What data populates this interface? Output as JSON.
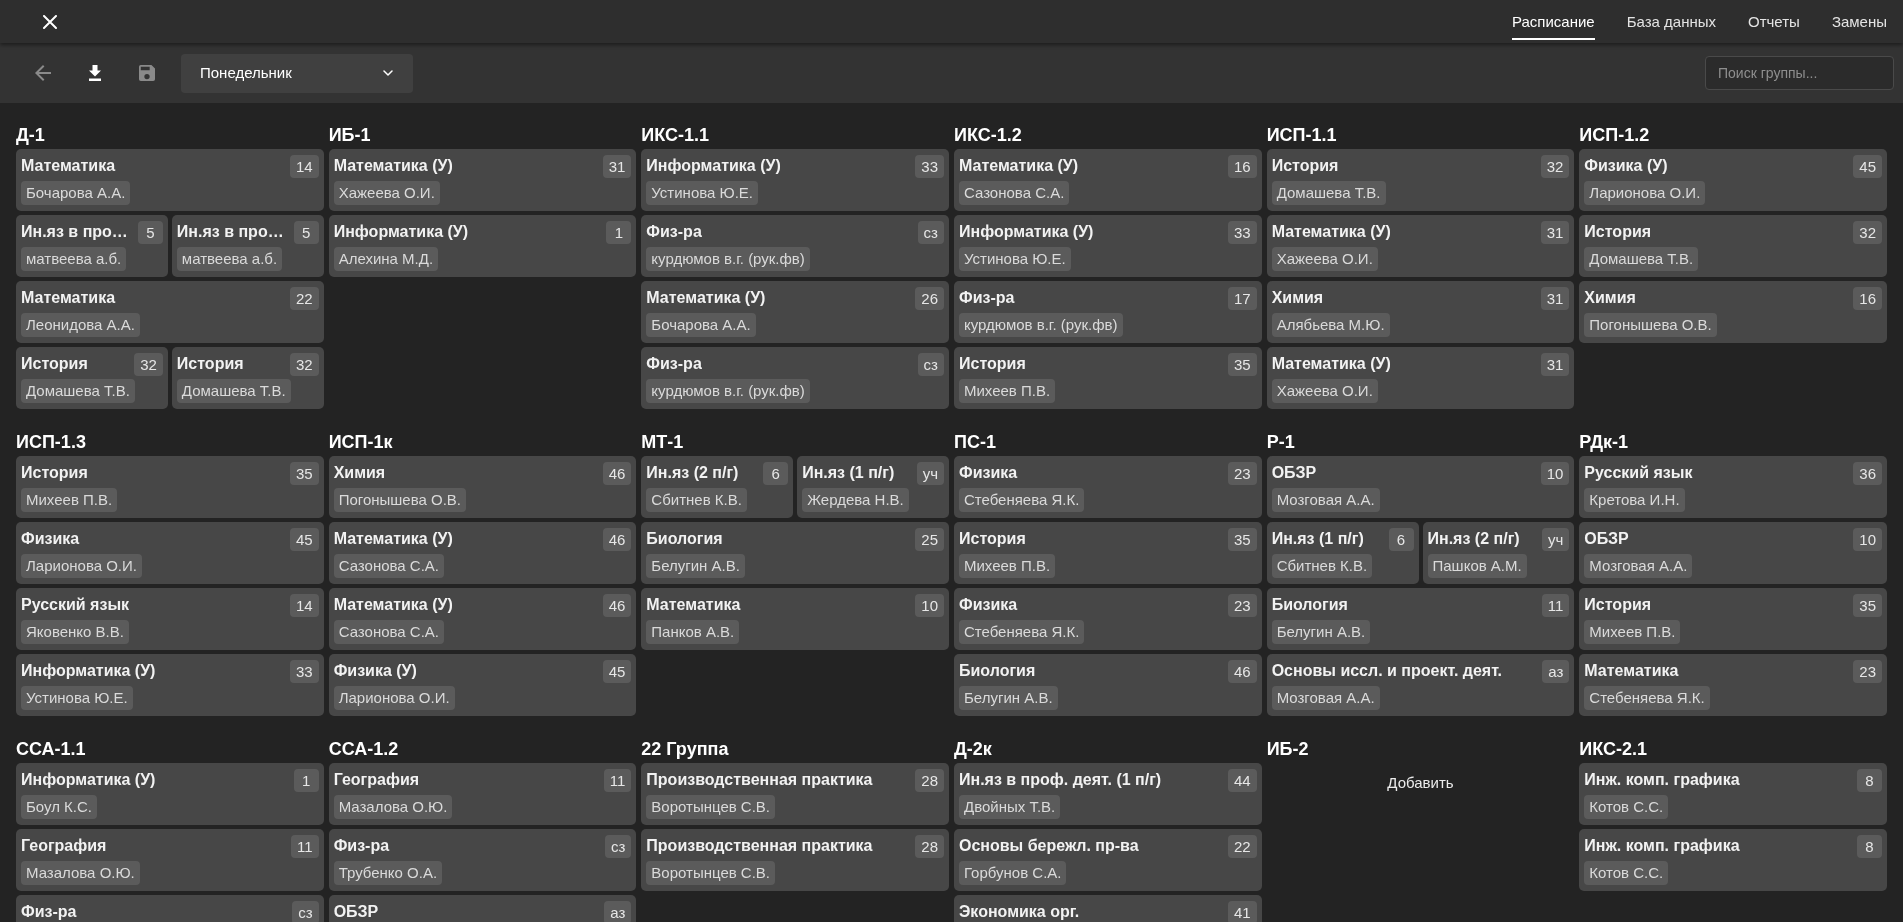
{
  "tabs": [
    {
      "label": "Расписание",
      "selected": true
    },
    {
      "label": "База данных",
      "selected": false
    },
    {
      "label": "Отчеты",
      "selected": false
    },
    {
      "label": "Замены",
      "selected": false
    }
  ],
  "toolbar": {
    "buttons": [
      {
        "kind": "back",
        "disabled": true
      },
      {
        "kind": "download",
        "disabled": false
      },
      {
        "kind": "save",
        "disabled": true
      }
    ],
    "day_select": {
      "value": "Понедельник"
    },
    "search": {
      "placeholder": "Поиск группы..."
    }
  },
  "groups": [
    {
      "name": "Д-1",
      "slots": [
        {
          "lessons": [
            {
              "subject": "Математика",
              "teacher": "Бочарова А.А.",
              "room": "14"
            }
          ]
        },
        {
          "lessons": [
            {
              "subject": "Ин.яз в про…",
              "teacher": "матвеева а.б.",
              "room": "5"
            },
            {
              "subject": "Ин.яз в про…",
              "teacher": "матвеева а.б.",
              "room": "5"
            }
          ]
        },
        {
          "lessons": [
            {
              "subject": "Математика",
              "teacher": "Леонидова А.А.",
              "room": "22"
            }
          ]
        },
        {
          "lessons": [
            {
              "subject": "История",
              "teacher": "Домашева Т.В.",
              "room": "32"
            },
            {
              "subject": "История",
              "teacher": "Домашева Т.В.",
              "room": "32"
            }
          ]
        }
      ]
    },
    {
      "name": "ИБ-1",
      "slots": [
        {
          "lessons": [
            {
              "subject": "Математика (У)",
              "teacher": "Хажеева О.И.",
              "room": "31"
            }
          ]
        },
        {
          "lessons": [
            {
              "subject": "Информатика (У)",
              "teacher": "Алехина М.Д.",
              "room": "1"
            }
          ]
        }
      ]
    },
    {
      "name": "ИКС-1.1",
      "slots": [
        {
          "lessons": [
            {
              "subject": "Информатика (У)",
              "teacher": "Устинова Ю.Е.",
              "room": "33"
            }
          ]
        },
        {
          "lessons": [
            {
              "subject": "Физ-ра",
              "teacher": "курдюмов в.г. (рук.фв)",
              "room": "сз"
            }
          ]
        },
        {
          "lessons": [
            {
              "subject": "Математика (У)",
              "teacher": "Бочарова А.А.",
              "room": "26"
            }
          ]
        },
        {
          "lessons": [
            {
              "subject": "Физ-ра",
              "teacher": "курдюмов в.г. (рук.фв)",
              "room": "сз"
            }
          ]
        }
      ]
    },
    {
      "name": "ИКС-1.2",
      "slots": [
        {
          "lessons": [
            {
              "subject": "Математика (У)",
              "teacher": "Сазонова С.А.",
              "room": "16"
            }
          ]
        },
        {
          "lessons": [
            {
              "subject": "Информатика (У)",
              "teacher": "Устинова Ю.Е.",
              "room": "33"
            }
          ]
        },
        {
          "lessons": [
            {
              "subject": "Физ-ра",
              "teacher": "курдюмов в.г. (рук.фв)",
              "room": "17"
            }
          ]
        },
        {
          "lessons": [
            {
              "subject": "История",
              "teacher": "Михеев П.В.",
              "room": "35"
            }
          ]
        }
      ]
    },
    {
      "name": "ИСП-1.1",
      "slots": [
        {
          "lessons": [
            {
              "subject": "История",
              "teacher": "Домашева Т.В.",
              "room": "32"
            }
          ]
        },
        {
          "lessons": [
            {
              "subject": "Математика (У)",
              "teacher": "Хажеева О.И.",
              "room": "31"
            }
          ]
        },
        {
          "lessons": [
            {
              "subject": "Химия",
              "teacher": "Алябьева М.Ю.",
              "room": "31"
            }
          ]
        },
        {
          "lessons": [
            {
              "subject": "Математика (У)",
              "teacher": "Хажеева О.И.",
              "room": "31"
            }
          ]
        }
      ]
    },
    {
      "name": "ИСП-1.2",
      "slots": [
        {
          "lessons": [
            {
              "subject": "Физика (У)",
              "teacher": "Ларионова О.И.",
              "room": "45"
            }
          ]
        },
        {
          "lessons": [
            {
              "subject": "История",
              "teacher": "Домашева Т.В.",
              "room": "32"
            }
          ]
        },
        {
          "lessons": [
            {
              "subject": "Химия",
              "teacher": "Погонышева О.В.",
              "room": "16"
            }
          ]
        }
      ]
    },
    {
      "name": "ИСП-1.3",
      "slots": [
        {
          "lessons": [
            {
              "subject": "История",
              "teacher": "Михеев П.В.",
              "room": "35"
            }
          ]
        },
        {
          "lessons": [
            {
              "subject": "Физика",
              "teacher": "Ларионова О.И.",
              "room": "45"
            }
          ]
        },
        {
          "lessons": [
            {
              "subject": "Русский язык",
              "teacher": "Яковенко В.В.",
              "room": "14"
            }
          ]
        },
        {
          "lessons": [
            {
              "subject": "Информатика (У)",
              "teacher": "Устинова Ю.Е.",
              "room": "33"
            }
          ]
        }
      ]
    },
    {
      "name": "ИСП-1к",
      "slots": [
        {
          "lessons": [
            {
              "subject": "Химия",
              "teacher": "Погонышева О.В.",
              "room": "46"
            }
          ]
        },
        {
          "lessons": [
            {
              "subject": "Математика (У)",
              "teacher": "Сазонова С.А.",
              "room": "46"
            }
          ]
        },
        {
          "lessons": [
            {
              "subject": "Математика (У)",
              "teacher": "Сазонова С.А.",
              "room": "46"
            }
          ]
        },
        {
          "lessons": [
            {
              "subject": "Физика (У)",
              "teacher": "Ларионова О.И.",
              "room": "45"
            }
          ]
        }
      ]
    },
    {
      "name": "МТ-1",
      "slots": [
        {
          "lessons": [
            {
              "subject": "Ин.яз (2 п/г)",
              "teacher": "Сбитнев К.В.",
              "room": "6"
            },
            {
              "subject": "Ин.яз (1 п/г)",
              "teacher": "Жердева Н.В.",
              "room": "уч"
            }
          ]
        },
        {
          "lessons": [
            {
              "subject": "Биология",
              "teacher": "Белугин А.В.",
              "room": "25"
            }
          ]
        },
        {
          "lessons": [
            {
              "subject": "Математика",
              "teacher": "Панков А.В.",
              "room": "10"
            }
          ]
        }
      ]
    },
    {
      "name": "ПС-1",
      "slots": [
        {
          "lessons": [
            {
              "subject": "Физика",
              "teacher": "Стебеняева Я.К.",
              "room": "23"
            }
          ]
        },
        {
          "lessons": [
            {
              "subject": "История",
              "teacher": "Михеев П.В.",
              "room": "35"
            }
          ]
        },
        {
          "lessons": [
            {
              "subject": "Физика",
              "teacher": "Стебеняева Я.К.",
              "room": "23"
            }
          ]
        },
        {
          "lessons": [
            {
              "subject": "Биология",
              "teacher": "Белугин А.В.",
              "room": "46"
            }
          ]
        }
      ]
    },
    {
      "name": "Р-1",
      "slots": [
        {
          "lessons": [
            {
              "subject": "ОБЗР",
              "teacher": "Мозговая А.А.",
              "room": "10"
            }
          ]
        },
        {
          "lessons": [
            {
              "subject": "Ин.яз (1 п/г)",
              "teacher": "Сбитнев К.В.",
              "room": "6"
            },
            {
              "subject": "Ин.яз (2 п/г)",
              "teacher": "Пашков А.М.",
              "room": "уч"
            }
          ]
        },
        {
          "lessons": [
            {
              "subject": "Биология",
              "teacher": "Белугин А.В.",
              "room": "11"
            }
          ]
        },
        {
          "lessons": [
            {
              "subject": "Основы иссл. и проект. деят.",
              "teacher": "Мозговая А.А.",
              "room": "аз"
            }
          ]
        }
      ]
    },
    {
      "name": "РДк-1",
      "slots": [
        {
          "lessons": [
            {
              "subject": "Русский язык",
              "teacher": "Кретова И.Н.",
              "room": "36"
            }
          ]
        },
        {
          "lessons": [
            {
              "subject": "ОБЗР",
              "teacher": "Мозговая А.А.",
              "room": "10"
            }
          ]
        },
        {
          "lessons": [
            {
              "subject": "История",
              "teacher": "Михеев П.В.",
              "room": "35"
            }
          ]
        },
        {
          "lessons": [
            {
              "subject": "Математика",
              "teacher": "Стебеняева Я.К.",
              "room": "23"
            }
          ]
        }
      ]
    },
    {
      "name": "ССА-1.1",
      "slots": [
        {
          "lessons": [
            {
              "subject": "Информатика (У)",
              "teacher": "Боул К.С.",
              "room": "1"
            }
          ]
        },
        {
          "lessons": [
            {
              "subject": "География",
              "teacher": "Мазалова О.Ю.",
              "room": "11"
            }
          ]
        },
        {
          "lessons": [
            {
              "subject": "Физ-ра",
              "room": "сз"
            }
          ]
        }
      ]
    },
    {
      "name": "ССА-1.2",
      "slots": [
        {
          "lessons": [
            {
              "subject": "География",
              "teacher": "Мазалова О.Ю.",
              "room": "11"
            }
          ]
        },
        {
          "lessons": [
            {
              "subject": "Физ-ра",
              "teacher": "Трубенко О.А.",
              "room": "сз"
            }
          ]
        },
        {
          "lessons": [
            {
              "subject": "ОБЗР",
              "room": "аз"
            }
          ]
        }
      ]
    },
    {
      "name": "22 Группа",
      "slots": [
        {
          "lessons": [
            {
              "subject": "Производственная практика",
              "teacher": "Воротынцев С.В.",
              "room": "28"
            }
          ]
        },
        {
          "lessons": [
            {
              "subject": "Производственная практика",
              "teacher": "Воротынцев С.В.",
              "room": "28"
            }
          ]
        }
      ]
    },
    {
      "name": "Д-2к",
      "slots": [
        {
          "lessons": [
            {
              "subject": "Ин.яз в проф. деят. (1 п/г)",
              "teacher": "Двойных Т.В.",
              "room": "44"
            }
          ]
        },
        {
          "lessons": [
            {
              "subject": "Основы бережл. пр-ва",
              "teacher": "Горбунов С.А.",
              "room": "22"
            }
          ]
        },
        {
          "lessons": [
            {
              "subject": "Экономика орг.",
              "room": "41"
            }
          ]
        }
      ]
    },
    {
      "name": "ИБ-2",
      "add_button": "Добавить"
    },
    {
      "name": "ИКС-2.1",
      "slots": [
        {
          "lessons": [
            {
              "subject": "Инж. комп. графика",
              "teacher": "Котов С.С.",
              "room": "8"
            }
          ]
        },
        {
          "lessons": [
            {
              "subject": "Инж. комп. графика",
              "teacher": "Котов С.С.",
              "room": "8"
            }
          ]
        }
      ]
    }
  ]
}
